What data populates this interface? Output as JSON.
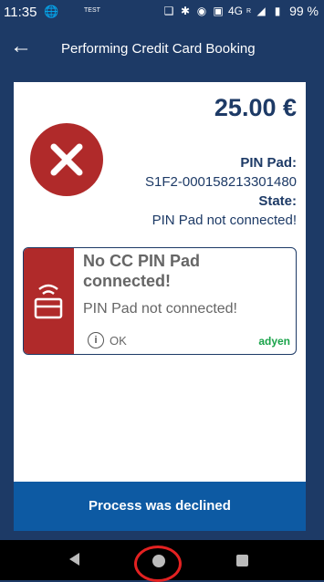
{
  "status_bar": {
    "time": "11:35",
    "test_label": "TEST",
    "network": "4G",
    "network_sup": "R",
    "battery_percent": "99 %"
  },
  "header": {
    "title": "Performing Credit Card Booking"
  },
  "card": {
    "amount": "25.00 €",
    "pin_pad_label": "PIN Pad:",
    "pin_pad_id": "S1F2-000158213301480",
    "state_label": "State:",
    "state_value": "PIN Pad not connected!"
  },
  "alert": {
    "title": "No CC PIN Pad connected!",
    "message": "PIN Pad not connected!",
    "ok_label": "OK",
    "brand": "adyen"
  },
  "footer": {
    "declined_label": "Process was declined"
  },
  "colors": {
    "background": "#1d3a66",
    "error_red": "#b02a2a",
    "declined_blue": "#0d5aa3",
    "adyen_green": "#1aa34a",
    "highlight_ring": "#e32121"
  }
}
